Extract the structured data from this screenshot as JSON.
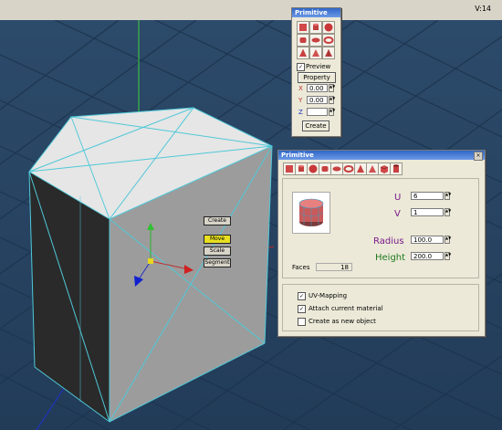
{
  "status": {
    "vertex_count": "V:14"
  },
  "small_palette": {
    "title": "Primitive",
    "tools": [
      "box-icon",
      "cylinder-icon",
      "sphere-icon",
      "rounded-cylinder-icon",
      "disc-icon",
      "torus-icon",
      "cone-icon",
      "prism-icon",
      "pyramid-icon"
    ],
    "preview_label": "Preview",
    "preview_checked": true,
    "property_button": "Property",
    "x_label": "X",
    "x_value": "0.00",
    "y_label": "Y",
    "y_value": "0.00",
    "z_label": "Z",
    "z_value": "",
    "create_button": "Create"
  },
  "primitive_window": {
    "title": "Primitive",
    "tools": [
      "box-icon",
      "cylinder-icon",
      "sphere-icon",
      "rounded-cylinder-icon",
      "disc-icon",
      "torus-icon",
      "cone-icon",
      "prism-icon",
      "cube-icon",
      "pipe-icon"
    ],
    "faces_label": "Faces",
    "faces_value": "18",
    "u_label": "U",
    "u_value": "6",
    "v_label": "V",
    "v_value": "1",
    "radius_label": "Radius",
    "radius_value": "100.0",
    "height_label": "Height",
    "height_value": "200.0",
    "uv_mapping_label": "UV-Mapping",
    "uv_mapping_checked": true,
    "attach_label": "Attach current material",
    "attach_checked": true,
    "new_object_label": "Create as new object",
    "new_object_checked": false,
    "colors": {
      "u_v": "#7a1a8a",
      "radius": "#7a1a8a",
      "height": "#1e7a1e"
    }
  },
  "gizmo_menu": {
    "create": "Create",
    "move": "Move",
    "scale": "Scale",
    "segment": "Segment",
    "active_color": "#e8e020"
  }
}
